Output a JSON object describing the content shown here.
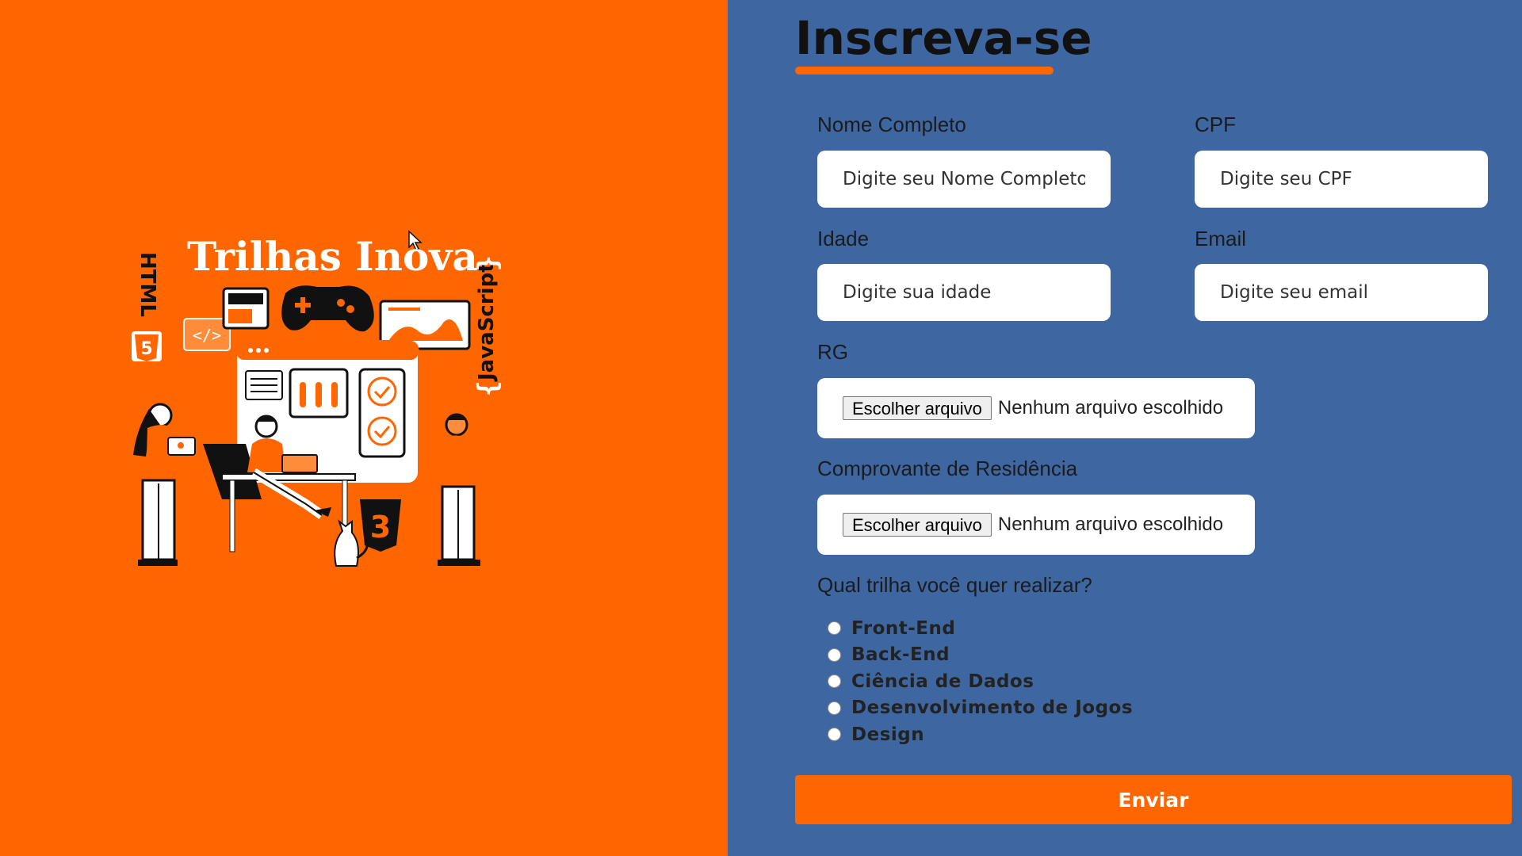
{
  "illustration": {
    "title": "Trilhas Inova",
    "badge_html": "HTML",
    "badge_js": "JavaScript",
    "code_tag": "</>"
  },
  "form": {
    "title": "Inscreva-se",
    "fields": {
      "nome": {
        "label": "Nome Completo",
        "placeholder": "Digite seu Nome Completo"
      },
      "cpf": {
        "label": "CPF",
        "placeholder": "Digite seu CPF"
      },
      "idade": {
        "label": "Idade",
        "placeholder": "Digite sua idade"
      },
      "email": {
        "label": "Email",
        "placeholder": "Digite seu email"
      }
    },
    "rg": {
      "label": "RG",
      "button": "Escolher arquivo",
      "status": "Nenhum arquivo escolhido"
    },
    "comprovante": {
      "label": "Comprovante de Residência",
      "button": "Escolher arquivo",
      "status": "Nenhum arquivo escolhido"
    },
    "trilha": {
      "question": "Qual trilha você quer realizar?",
      "options": [
        "Front-End",
        "Back-End",
        "Ciência de Dados",
        "Desenvolvimento de Jogos",
        "Design"
      ]
    },
    "submit_label": "Enviar"
  },
  "colors": {
    "left_bg": "#ff6600",
    "right_bg": "#3e67a2",
    "accent": "#ff6600"
  }
}
